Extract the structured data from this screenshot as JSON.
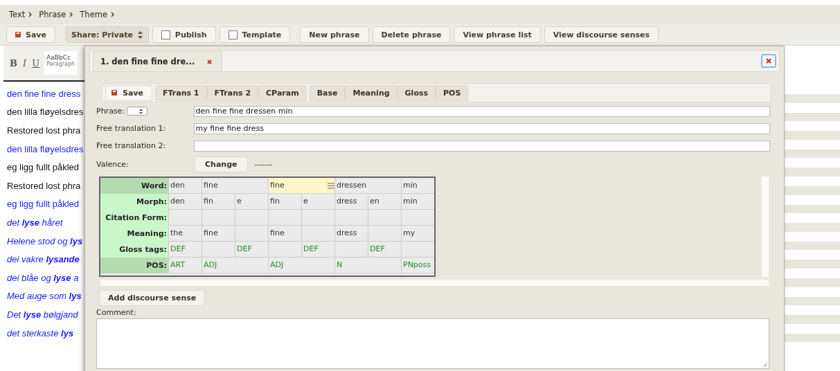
{
  "breadcrumb": [
    {
      "label": "Text"
    },
    {
      "label": "Phrase"
    },
    {
      "label": "Theme"
    }
  ],
  "toolbar": [
    [
      {
        "kind": "save",
        "label": "Save"
      }
    ],
    [
      {
        "kind": "select",
        "label": "Share: Private"
      },
      {
        "kind": "checkbox",
        "label": "Publish",
        "checked": false
      },
      {
        "kind": "checkbox",
        "label": "Template",
        "checked": false
      }
    ],
    [
      {
        "kind": "button",
        "label": "New phrase"
      },
      {
        "kind": "button",
        "label": "Delete phrase"
      },
      {
        "kind": "button",
        "label": "View phrase list"
      },
      {
        "kind": "button",
        "label": "View discourse senses"
      }
    ]
  ],
  "editor_toolbar": {
    "buttons": [
      {
        "kind": "bold",
        "label": "B"
      },
      {
        "kind": "italic",
        "label": "I"
      },
      {
        "kind": "underline",
        "label": "U"
      }
    ],
    "style_preview": "AaBbCc",
    "style_name": "Paragraph"
  },
  "phrase_list": [
    {
      "kind": "link",
      "text": "den fine fine dress"
    },
    {
      "kind": "plain",
      "text": "den lilla fløyelsdres"
    },
    {
      "kind": "plain",
      "text": "Restored lost phra"
    },
    {
      "kind": "link",
      "text": "den lilla fløyelsdres"
    },
    {
      "kind": "plain",
      "text": "eg ligg fullt påkled"
    },
    {
      "kind": "plain",
      "text": "Restored lost phra"
    },
    {
      "kind": "link",
      "text": "eg ligg fullt påkled"
    },
    {
      "kind": "match",
      "text": "det **lyse** håret"
    },
    {
      "kind": "match",
      "text": "Helene stod og **lys**"
    },
    {
      "kind": "match",
      "text": "dei vakre **lysande**"
    },
    {
      "kind": "match",
      "text": "dei blåe og **lyse** a"
    },
    {
      "kind": "match",
      "text": "Med auge som **lys**"
    },
    {
      "kind": "match",
      "text": "Det **lyse** bølgjand"
    },
    {
      "kind": "match",
      "text": "det sterkaste **lys**"
    }
  ],
  "dialog": {
    "tab": {
      "label": "1. den fine fine dre...",
      "selected": true
    },
    "toolbar": [
      [
        {
          "kind": "save",
          "label": "Save"
        }
      ],
      [
        {
          "kind": "button",
          "label": "FTrans 1"
        },
        {
          "kind": "button",
          "label": "FTrans 2"
        },
        {
          "kind": "button",
          "label": "CParam"
        }
      ],
      [
        {
          "kind": "button",
          "label": "Base"
        },
        {
          "kind": "button",
          "label": "Meaning"
        },
        {
          "kind": "button",
          "label": "Gloss"
        },
        {
          "kind": "button",
          "label": "POS"
        }
      ]
    ],
    "fields": [
      {
        "kind": "select",
        "label": "Phrase:",
        "value": "den fine fine dressen min"
      },
      {
        "kind": "text",
        "label": "Free translation 1:",
        "value": "my fine fine dress"
      },
      {
        "kind": "text",
        "label": "Free translation 2:"
      }
    ],
    "valence": {
      "label": "Valence:",
      "button": "Change",
      "value": "-------"
    },
    "interlinear": {
      "row_labels": [
        "Word:",
        "Morph:",
        "Citation Form:",
        "Meaning:",
        "Gloss tags:",
        "POS:"
      ],
      "words": [
        {
          "text": "den",
          "pos": "ART",
          "selected": false,
          "morphs": [
            {
              "form": "den",
              "meaning": "the",
              "gloss": "DEF"
            }
          ]
        },
        {
          "text": "fine",
          "pos": "ADJ",
          "selected": false,
          "morphs": [
            {
              "form": "fin",
              "meaning": "fine"
            },
            {
              "form": "e",
              "gloss": "DEF"
            }
          ]
        },
        {
          "text": "fine",
          "pos": "ADJ",
          "selected": true,
          "morphs": [
            {
              "form": "fin",
              "meaning": "fine"
            },
            {
              "form": "e",
              "gloss": "DEF"
            }
          ]
        },
        {
          "text": "dressen",
          "pos": "N",
          "selected": false,
          "morphs": [
            {
              "form": "dress",
              "meaning": "dress"
            },
            {
              "form": "en",
              "gloss": "DEF"
            }
          ]
        },
        {
          "text": "min",
          "pos": "PNposs",
          "selected": false,
          "morphs": [
            {
              "form": "min",
              "meaning": "my"
            }
          ]
        }
      ]
    },
    "add_button": "Add discourse sense",
    "comment": {
      "label": "Comment:"
    }
  }
}
